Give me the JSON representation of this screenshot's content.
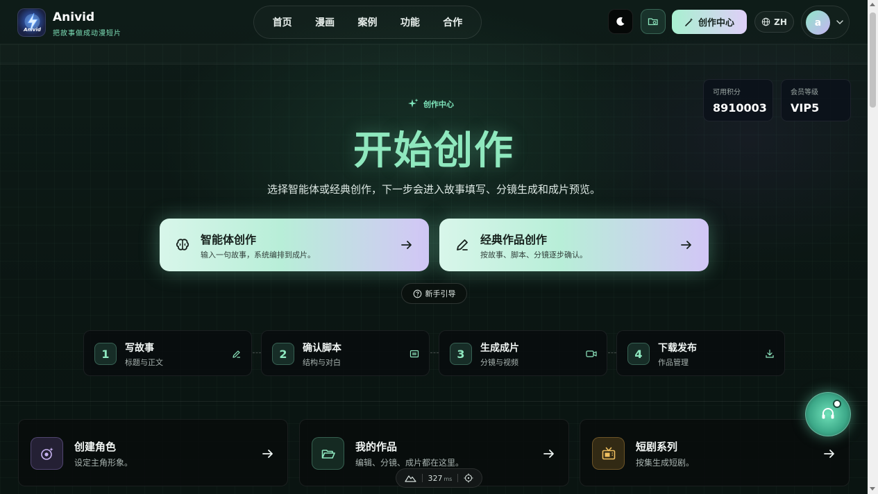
{
  "header": {
    "brand": "Anivid",
    "tagline": "把故事做成动漫短片",
    "logo_text": "Anivid",
    "nav": [
      "首页",
      "漫画",
      "案例",
      "功能",
      "合作"
    ],
    "create_center_label": "创作中心",
    "language": "ZH",
    "avatar_letter": "a"
  },
  "stats": [
    {
      "label": "可用积分",
      "value": "8910003"
    },
    {
      "label": "会员等级",
      "value": "VIP5"
    }
  ],
  "hero": {
    "eyebrow": "创作中心",
    "title": "开始创作",
    "subtitle": "选择智能体或经典创作，下一步会进入故事填写、分镜生成和成片预览。"
  },
  "modes": [
    {
      "icon": "brain-icon",
      "title": "智能体创作",
      "desc": "输入一句故事，系统编排到成片。"
    },
    {
      "icon": "pencil-icon",
      "title": "经典作品创作",
      "desc": "按故事、脚本、分镜逐步确认。"
    }
  ],
  "guide_label": "新手引导",
  "steps": [
    {
      "num": "1",
      "title": "写故事",
      "desc": "标题与正文",
      "icon": "edit-icon"
    },
    {
      "num": "2",
      "title": "确认脚本",
      "desc": "结构与对白",
      "icon": "film-icon"
    },
    {
      "num": "3",
      "title": "生成成片",
      "desc": "分镜与视频",
      "icon": "video-icon"
    },
    {
      "num": "4",
      "title": "下载发布",
      "desc": "作品管理",
      "icon": "download-icon"
    }
  ],
  "features": [
    {
      "title": "创建角色",
      "desc": "设定主角形象。",
      "icon": "character-icon"
    },
    {
      "title": "我的作品",
      "desc": "编辑、分镜、成片都在这里。",
      "icon": "folder-open-icon"
    },
    {
      "title": "短剧系列",
      "desc": "按集生成短剧。",
      "icon": "tv-icon"
    }
  ],
  "perf": {
    "value": "327",
    "unit": "ms"
  },
  "colors": {
    "accent": "#8fe8be",
    "gradient_start": "#b8eed8",
    "gradient_end": "#d2c6f6",
    "background": "#0b1512"
  }
}
